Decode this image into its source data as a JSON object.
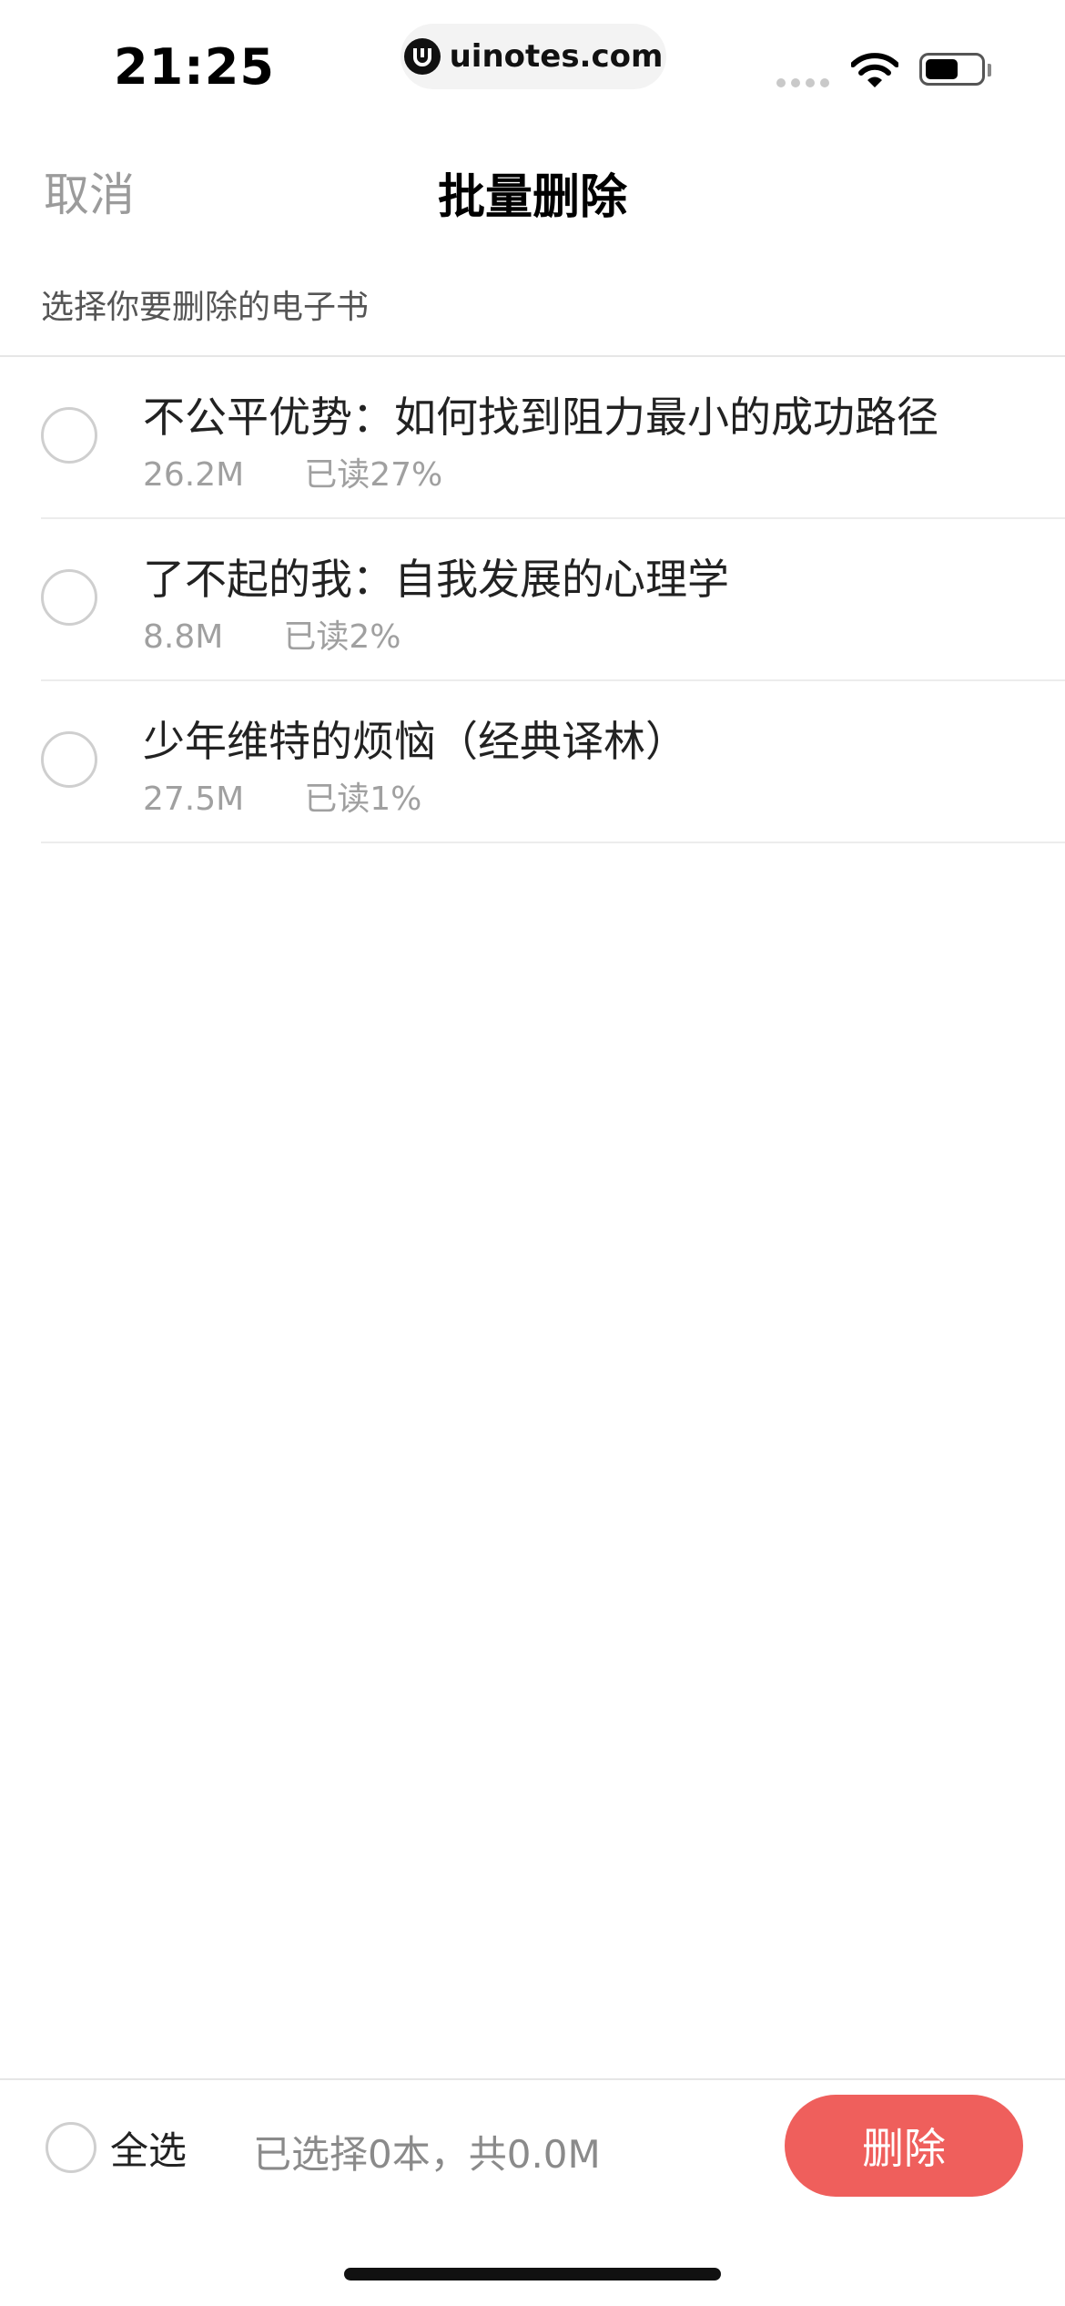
{
  "status_bar": {
    "time": "21:25",
    "url": "uinotes.com",
    "battery_level": 0.6
  },
  "nav": {
    "cancel_label": "取消",
    "title": "批量删除"
  },
  "hint": "选择你要删除的电子书",
  "books": [
    {
      "title": "不公平优势：如何找到阻力最小的成功路径",
      "size": "26.2M",
      "progress": "已读27%",
      "selected": false
    },
    {
      "title": "了不起的我：自我发展的心理学",
      "size": "8.8M",
      "progress": "已读2%",
      "selected": false
    },
    {
      "title": "少年维特的烦恼（经典译林）",
      "size": "27.5M",
      "progress": "已读1%",
      "selected": false
    }
  ],
  "bottom_bar": {
    "select_all_label": "全选",
    "summary": "已选择0本，共0.0M",
    "delete_label": "删除"
  },
  "colors": {
    "accent": "#ef5f5c",
    "muted_text": "#9b9b9b"
  }
}
